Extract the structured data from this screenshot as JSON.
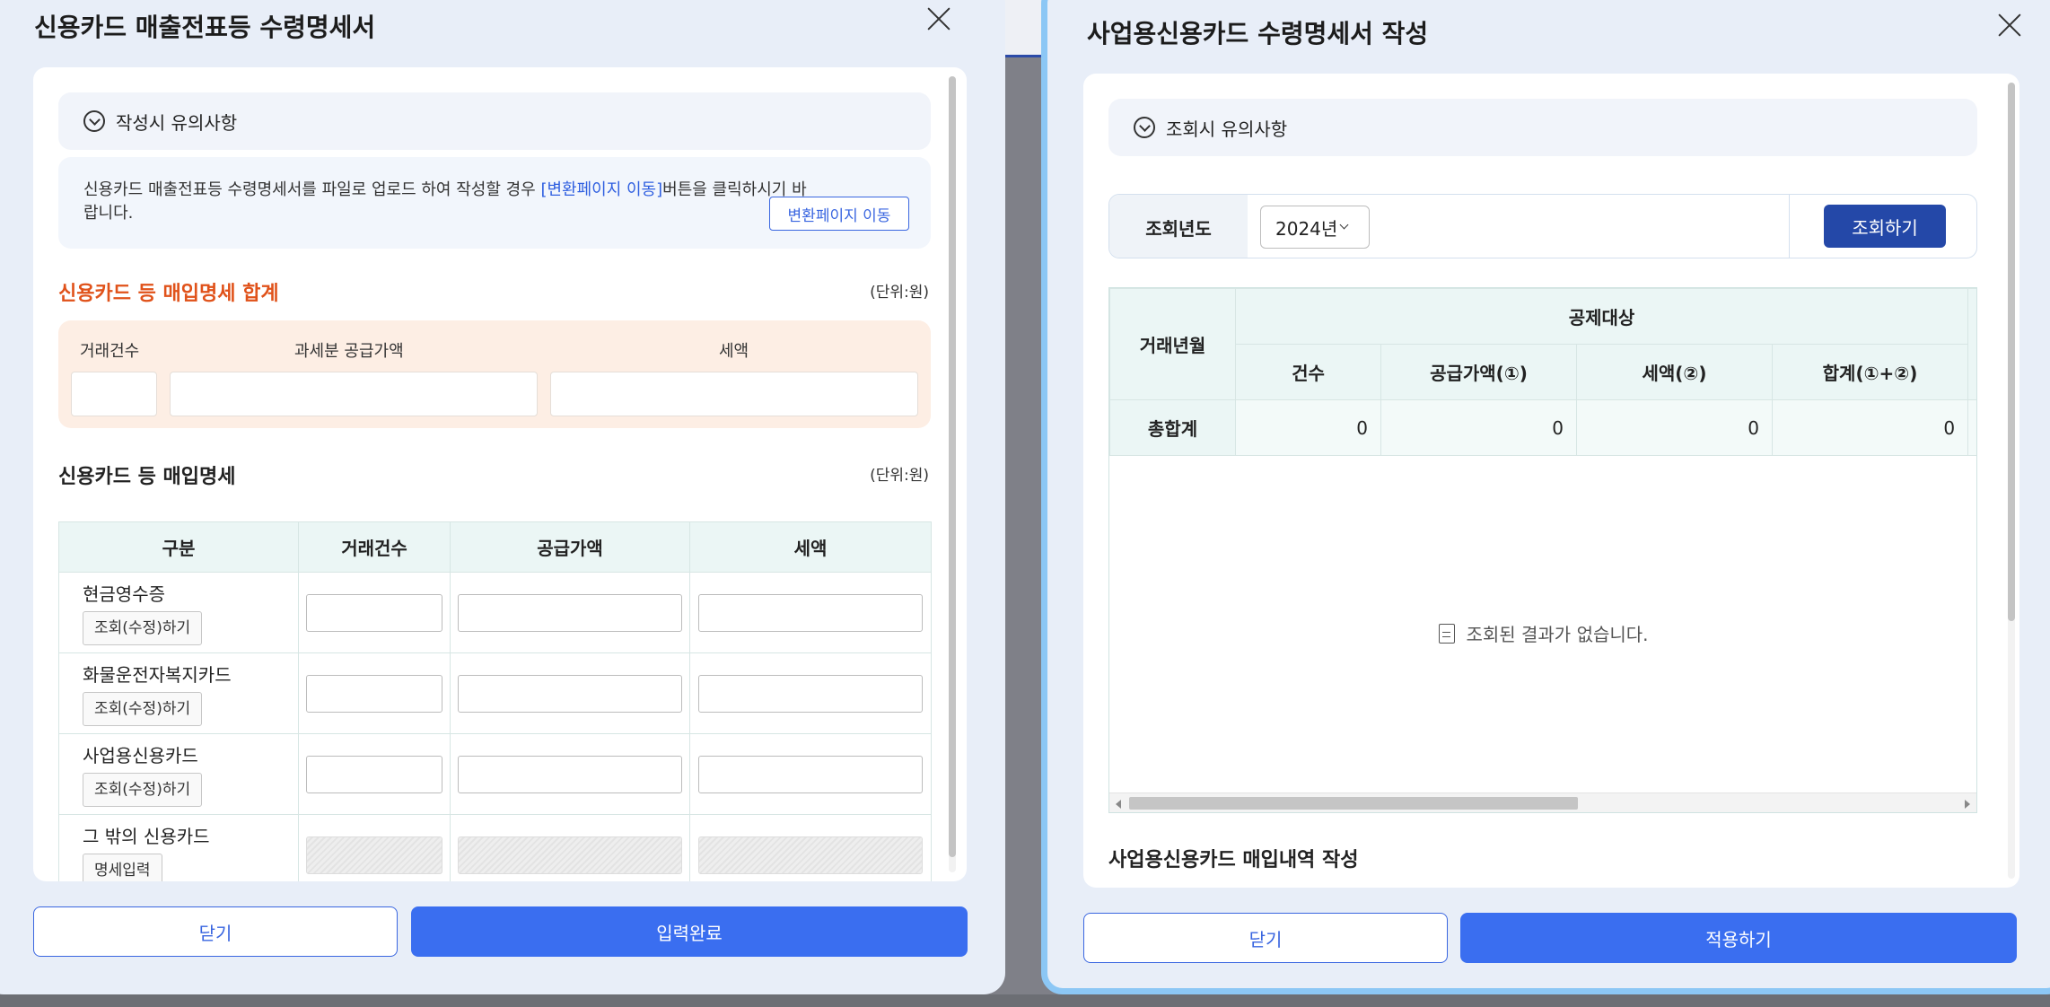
{
  "left": {
    "title": "신용카드 매출전표등 수령명세서",
    "notice_label": "작성시 유의사항",
    "info_text_1": "신용카드 매출전표등 수령명세서를 파일로 업로드 하여 작성할 경우 ",
    "info_link": "[변환페이지 이동]",
    "info_text_2": "버튼을 클릭하시기 바랍니다.",
    "convert_button": "변환페이지 이동",
    "summary_title": "신용카드 등 매입명세 합계",
    "unit": "(단위:원)",
    "summary_labels": {
      "count": "거래건수",
      "supply": "과세분 공급가액",
      "tax": "세액"
    },
    "detail_title": "신용카드 등 매입명세",
    "table_headers": [
      "구분",
      "거래건수",
      "공급가액",
      "세액"
    ],
    "rows": [
      {
        "name": "현금영수증",
        "button": "조회(수정)하기"
      },
      {
        "name": "화물운전자복지카드",
        "button": "조회(수정)하기"
      },
      {
        "name": "사업용신용카드",
        "button": "조회(수정)하기"
      },
      {
        "name": "그 밖의 신용카드",
        "button": "명세입력"
      }
    ],
    "close_button": "닫기",
    "submit_button": "입력완료"
  },
  "right": {
    "title": "사업용신용카드 수령명세서 작성",
    "notice_label": "조회시 유의사항",
    "filter_label": "조회년도",
    "year": "2024년",
    "search_button": "조회하기",
    "col_month": "거래년월",
    "col_group": "공제대상",
    "sub_headers": [
      "건수",
      "공급가액(①)",
      "세액(②)",
      "합계(①+②)"
    ],
    "total_label": "총합계",
    "totals": [
      "0",
      "0",
      "0",
      "0"
    ],
    "empty_message": "조회된 결과가 없습니다.",
    "bottom_section": "사업용신용카드 매입내역 작성",
    "close_button": "닫기",
    "apply_button": "적용하기"
  }
}
